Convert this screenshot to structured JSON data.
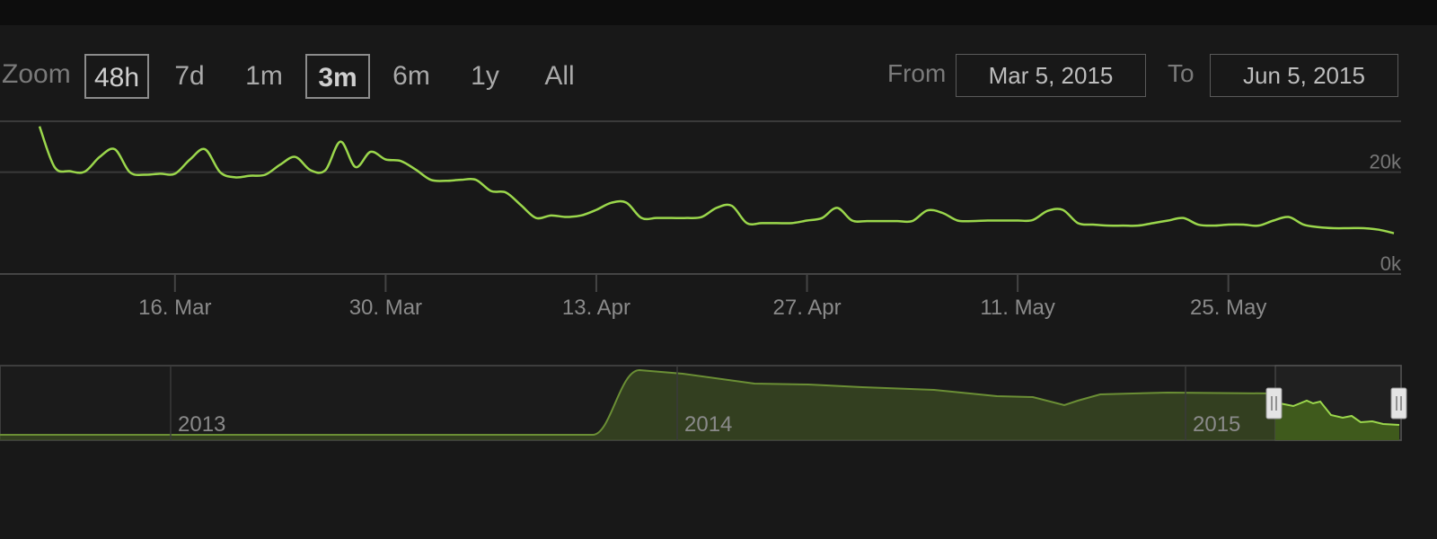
{
  "zoom": {
    "label": "Zoom",
    "buttons": [
      "48h",
      "7d",
      "1m",
      "3m",
      "6m",
      "1y",
      "All"
    ],
    "selected": "3m"
  },
  "range": {
    "from_label": "From",
    "from_value": "Mar 5, 2015",
    "to_label": "To",
    "to_value": "Jun 5, 2015"
  },
  "colors": {
    "line": "#9bd74c",
    "navigator_fill": "#3d4f22",
    "background": "#181818"
  },
  "chart_data": {
    "type": "line",
    "title": "",
    "xlabel": "",
    "ylabel": "",
    "x_ticks": [
      "16. Mar",
      "30. Mar",
      "13. Apr",
      "27. Apr",
      "11. May",
      "25. May"
    ],
    "y_ticks": [
      "0k",
      "20k"
    ],
    "ylim": [
      0,
      30000
    ],
    "grid": true,
    "series": [
      {
        "x": [
          "2015-03-07",
          "2015-03-08",
          "2015-03-09",
          "2015-03-10",
          "2015-03-11",
          "2015-03-12",
          "2015-03-13",
          "2015-03-14",
          "2015-03-15",
          "2015-03-16",
          "2015-03-17",
          "2015-03-18",
          "2015-03-19",
          "2015-03-20",
          "2015-03-21",
          "2015-03-22",
          "2015-03-23",
          "2015-03-24",
          "2015-03-25",
          "2015-03-26",
          "2015-03-27",
          "2015-03-28",
          "2015-03-29",
          "2015-03-30",
          "2015-03-31",
          "2015-04-01",
          "2015-04-02",
          "2015-04-03",
          "2015-04-04",
          "2015-04-05",
          "2015-04-06",
          "2015-04-07",
          "2015-04-08",
          "2015-04-09",
          "2015-04-10",
          "2015-04-11",
          "2015-04-12",
          "2015-04-13",
          "2015-04-14",
          "2015-04-15",
          "2015-04-16",
          "2015-04-17",
          "2015-04-18",
          "2015-04-19",
          "2015-04-20",
          "2015-04-21",
          "2015-04-22",
          "2015-04-23",
          "2015-04-24",
          "2015-04-25",
          "2015-04-26",
          "2015-04-27",
          "2015-04-28",
          "2015-04-29",
          "2015-04-30",
          "2015-05-01",
          "2015-05-02",
          "2015-05-03",
          "2015-05-04",
          "2015-05-05",
          "2015-05-06",
          "2015-05-07",
          "2015-05-08",
          "2015-05-09",
          "2015-05-10",
          "2015-05-11",
          "2015-05-12",
          "2015-05-13",
          "2015-05-14",
          "2015-05-15",
          "2015-05-16",
          "2015-05-17",
          "2015-05-18",
          "2015-05-19",
          "2015-05-20",
          "2015-05-21",
          "2015-05-22",
          "2015-05-23",
          "2015-05-24",
          "2015-05-25",
          "2015-05-26",
          "2015-05-27",
          "2015-05-28",
          "2015-05-29",
          "2015-05-30",
          "2015-05-31",
          "2015-06-01",
          "2015-06-02",
          "2015-06-03",
          "2015-06-04",
          "2015-06-05"
        ],
        "y": [
          29000,
          21000,
          20200,
          20100,
          23000,
          24500,
          20000,
          19500,
          19700,
          19700,
          22500,
          24500,
          20000,
          19000,
          19300,
          19500,
          21500,
          23000,
          20400,
          20400,
          26000,
          21000,
          24000,
          22500,
          22200,
          20500,
          18500,
          18300,
          18500,
          18500,
          16300,
          16000,
          13500,
          11000,
          11500,
          11200,
          11500,
          12600,
          14000,
          14000,
          11000,
          11000,
          11000,
          11000,
          11200,
          13000,
          13400,
          10000,
          10000,
          10000,
          10000,
          10500,
          11000,
          13000,
          10500,
          10400,
          10400,
          10400,
          10400,
          12500,
          12000,
          10500,
          10400,
          10500,
          10500,
          10500,
          10600,
          12400,
          12600,
          10000,
          9700,
          9500,
          9500,
          9500,
          10000,
          10500,
          11000,
          9700,
          9500,
          9700,
          9700,
          9500,
          10500,
          11200,
          9700,
          9200,
          9000,
          9000,
          9000,
          8700,
          8000
        ]
      }
    ],
    "navigator": {
      "x_labels": [
        "2013",
        "2014",
        "2015"
      ]
    }
  }
}
